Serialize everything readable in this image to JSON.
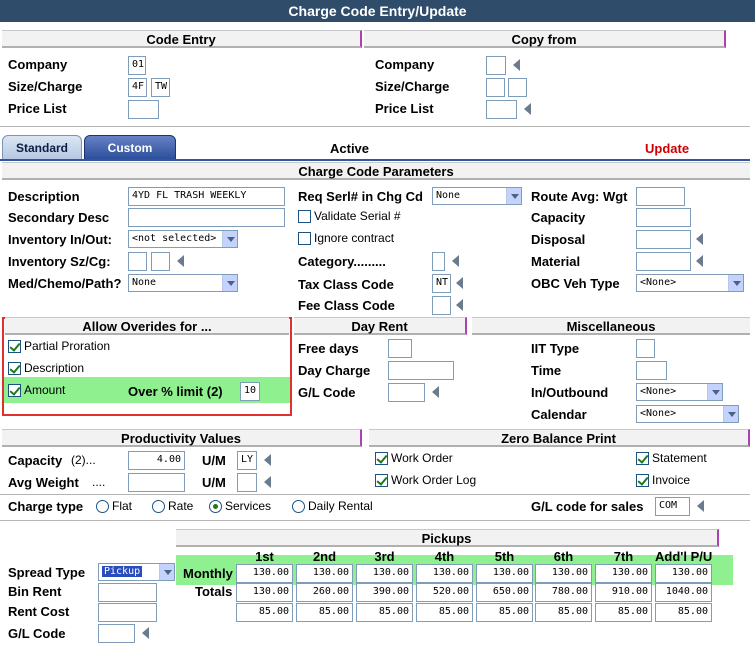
{
  "title": "Charge Code Entry/Update",
  "code_entry": {
    "heading": "Code Entry",
    "company_label": "Company",
    "company_value": "01",
    "size_charge_label": "Size/Charge",
    "size_value": "4F",
    "charge_value": "TW",
    "price_list_label": "Price List",
    "price_list_value": ""
  },
  "copy_from": {
    "heading": "Copy from",
    "company_label": "Company",
    "size_charge_label": "Size/Charge",
    "price_list_label": "Price List"
  },
  "tabs": {
    "standard": "Standard",
    "custom": "Custom"
  },
  "status": {
    "active": "Active",
    "update": "Update"
  },
  "params": {
    "heading": "Charge Code Parameters",
    "description_label": "Description",
    "description_value": "4YD FL TRASH WEEKLY",
    "secondary_desc_label": "Secondary Desc",
    "inventory_inout_label": "Inventory In/Out:",
    "inventory_inout_value": "<not selected>",
    "inventory_szcg_label": "Inventory Sz/Cg:",
    "med_label": "Med/Chemo/Path?",
    "med_value": "None",
    "req_serl_label": "Req Serl# in Chg Cd",
    "req_serl_value": "None",
    "validate_serial_label": "Validate Serial #",
    "ignore_contract_label": "Ignore contract",
    "category_label": "Category.........",
    "tax_class_label": "Tax Class Code",
    "tax_class_value": "NT",
    "fee_class_label": "Fee Class Code",
    "route_avg_label": "Route Avg: Wgt",
    "capacity_label": "Capacity",
    "disposal_label": "Disposal",
    "material_label": "Material",
    "obc_label": "OBC Veh Type",
    "obc_value": "<None>"
  },
  "overrides": {
    "heading": "Allow Overides for ...",
    "partial_proration": "Partial Proration",
    "description": "Description",
    "amount": "Amount",
    "over_limit_label": "Over % limit (2)",
    "over_limit_value": "10"
  },
  "day_rent": {
    "heading": "Day Rent",
    "free_days_label": "Free days",
    "day_charge_label": "Day Charge",
    "gl_code_label": "G/L Code"
  },
  "misc": {
    "heading": "Miscellaneous",
    "iit_label": "IIT Type",
    "time_label": "Time",
    "inoutbound_label": "In/Outbound",
    "inoutbound_value": "<None>",
    "calendar_label": "Calendar",
    "calendar_value": "<None>"
  },
  "productivity": {
    "heading": "Productivity Values",
    "capacity_label": "Capacity",
    "capacity_sub": "(2)...",
    "capacity_value": "4.00",
    "um_label": "U/M",
    "um_value": "LY",
    "avg_weight_label": "Avg Weight",
    "avg_weight_sub": "...."
  },
  "zero_balance": {
    "heading": "Zero Balance Print",
    "work_order": "Work Order",
    "work_order_log": "Work Order Log",
    "statement": "Statement",
    "invoice": "Invoice"
  },
  "charge_type": {
    "label": "Charge type",
    "options": [
      "Flat",
      "Rate",
      "Services",
      "Daily Rental"
    ],
    "selected": "Services",
    "gl_sales_label": "G/L code for sales",
    "gl_sales_value": "COM"
  },
  "pickups": {
    "heading": "Pickups",
    "spread_type_label": "Spread Type",
    "spread_type_value": "Pickup",
    "bin_rent_label": "Bin Rent",
    "rent_cost_label": "Rent Cost",
    "gl_code_label": "G/L Code",
    "columns": [
      "1st",
      "2nd",
      "3rd",
      "4th",
      "5th",
      "6th",
      "7th",
      "Add'l P/U"
    ],
    "monthly_label": "Monthly",
    "monthly": [
      "130.00",
      "130.00",
      "130.00",
      "130.00",
      "130.00",
      "130.00",
      "130.00",
      "130.00"
    ],
    "totals_label": "Totals",
    "totals": [
      "130.00",
      "260.00",
      "390.00",
      "520.00",
      "650.00",
      "780.00",
      "910.00",
      "1040.00"
    ],
    "rent_cost": [
      "85.00",
      "85.00",
      "85.00",
      "85.00",
      "85.00",
      "85.00",
      "85.00",
      "85.00"
    ]
  },
  "colors": {
    "title_bar": "#2f4d6a",
    "highlight": "#8ef08e",
    "update_red": "#cc0000",
    "border_red": "#e03030",
    "tab_blue": "#3355a0"
  }
}
